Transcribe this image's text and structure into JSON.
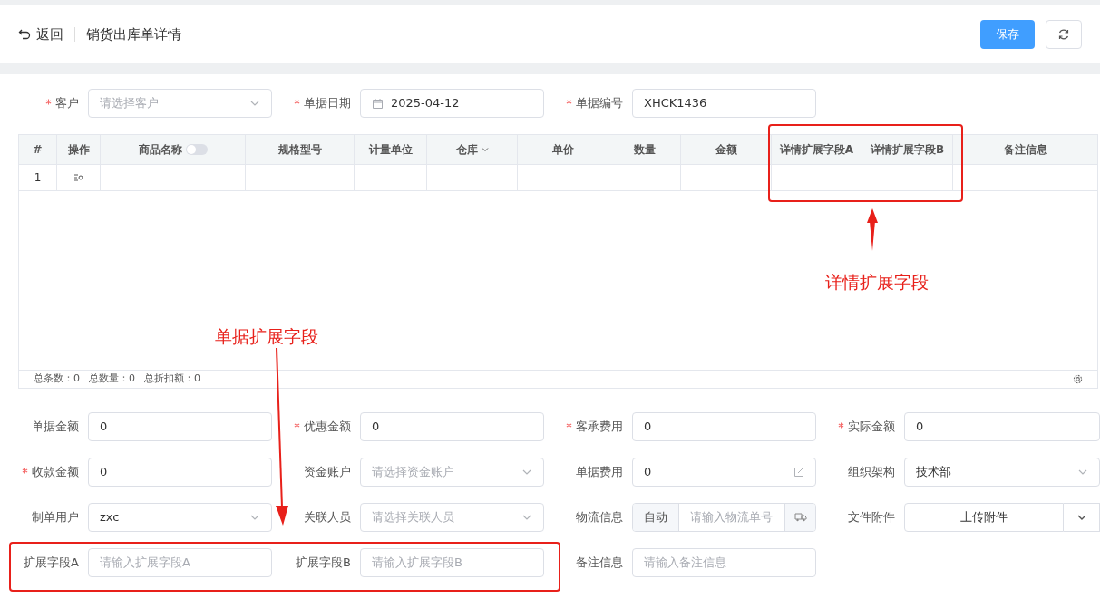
{
  "header": {
    "back_label": "返回",
    "title": "销货出库单详情",
    "save_label": "保存"
  },
  "top_fields": [
    {
      "label": "客户",
      "required": true,
      "kind": "select",
      "placeholder": "请选择客户"
    },
    {
      "label": "单据日期",
      "required": true,
      "kind": "date",
      "value": "2025-04-12"
    },
    {
      "label": "单据编号",
      "required": true,
      "kind": "text",
      "value": "XHCK1436"
    }
  ],
  "table": {
    "columns": [
      {
        "label": "#",
        "kind": "plain"
      },
      {
        "label": "操作",
        "kind": "plain"
      },
      {
        "label": "商品名称",
        "kind": "toggle",
        "on": false
      },
      {
        "label": "规格型号",
        "kind": "plain"
      },
      {
        "label": "计量单位",
        "kind": "plain"
      },
      {
        "label": "仓库",
        "kind": "sort"
      },
      {
        "label": "单价",
        "kind": "plain"
      },
      {
        "label": "数量",
        "kind": "plain"
      },
      {
        "label": "金额",
        "kind": "plain"
      },
      {
        "label": "详情扩展字段A",
        "kind": "plain"
      },
      {
        "label": "详情扩展字段B",
        "kind": "plain"
      },
      {
        "label": "备注信息",
        "kind": "plain"
      }
    ],
    "rows": [
      {
        "index": "1"
      }
    ],
    "totals": [
      "总条数：0",
      "总数量：0",
      "总折扣额：0"
    ]
  },
  "bottom_fields": [
    {
      "label": "单据金额",
      "required": false,
      "kind": "text",
      "value": "0"
    },
    {
      "label": "优惠金额",
      "required": true,
      "kind": "text",
      "value": "0"
    },
    {
      "label": "客承费用",
      "required": true,
      "kind": "text",
      "value": "0"
    },
    {
      "label": "实际金额",
      "required": true,
      "kind": "text",
      "value": "0"
    },
    {
      "label": "收款金额",
      "required": true,
      "kind": "text",
      "value": "0"
    },
    {
      "label": "资金账户",
      "required": false,
      "kind": "select",
      "placeholder": "请选择资金账户"
    },
    {
      "label": "单据费用",
      "required": false,
      "kind": "edit",
      "value": "0"
    },
    {
      "label": "组织架构",
      "required": false,
      "kind": "select",
      "value": "技术部"
    },
    {
      "label": "制单用户",
      "required": false,
      "kind": "select",
      "value": "zxc"
    },
    {
      "label": "关联人员",
      "required": false,
      "kind": "select",
      "placeholder": "请选择关联人员"
    },
    {
      "label": "物流信息",
      "required": false,
      "kind": "logistics",
      "addon": "自动",
      "placeholder": "请输入物流单号"
    },
    {
      "label": "文件附件",
      "required": false,
      "kind": "upload",
      "value": "上传附件"
    },
    {
      "label": "扩展字段A",
      "required": false,
      "kind": "text",
      "placeholder": "请输入扩展字段A"
    },
    {
      "label": "扩展字段B",
      "required": false,
      "kind": "text",
      "placeholder": "请输入扩展字段B"
    },
    {
      "label": "备注信息",
      "required": false,
      "kind": "text",
      "placeholder": "请输入备注信息"
    }
  ],
  "annotations": {
    "detail_label": "详情扩展字段",
    "bill_label": "单据扩展字段"
  }
}
